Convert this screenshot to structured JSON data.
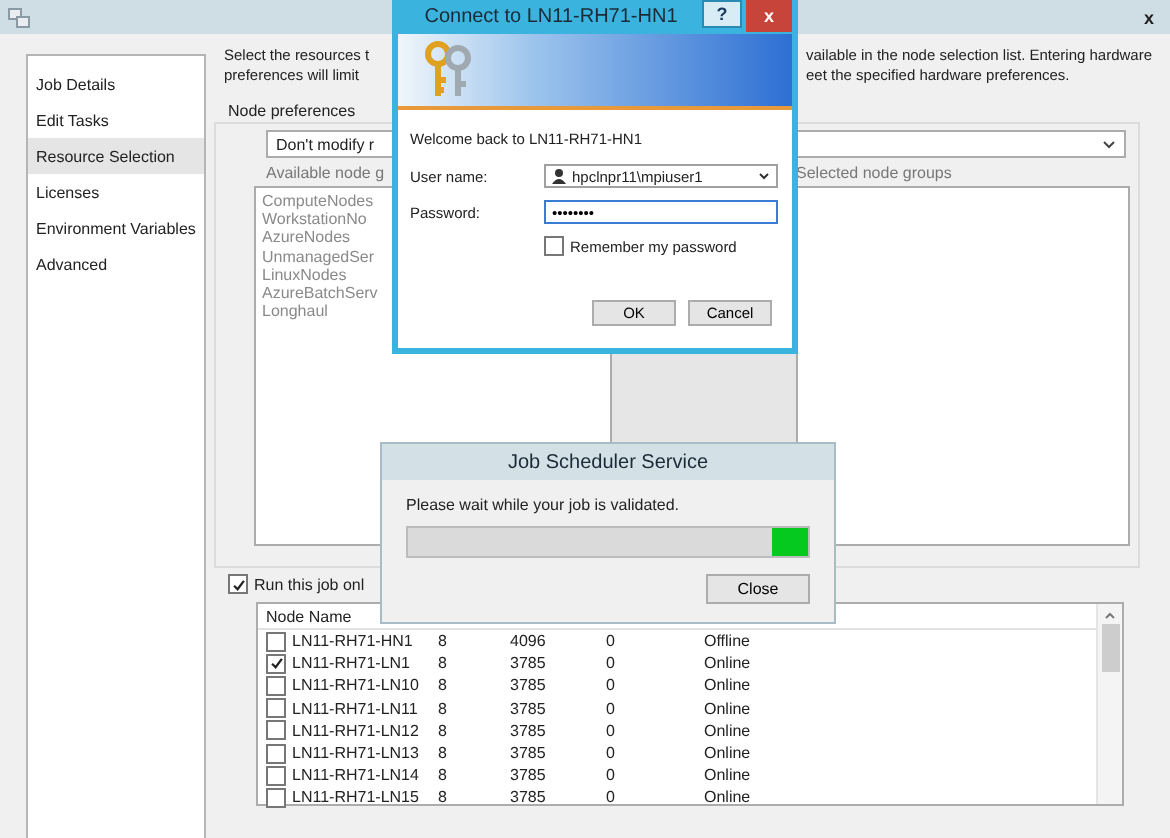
{
  "sidebar": {
    "items": [
      {
        "label": "Job Details",
        "selected": false
      },
      {
        "label": "Edit Tasks",
        "selected": false
      },
      {
        "label": "Resource Selection",
        "selected": true
      },
      {
        "label": "Licenses",
        "selected": false
      },
      {
        "label": "Environment Variables",
        "selected": false
      },
      {
        "label": "Advanced",
        "selected": false
      }
    ]
  },
  "description": {
    "left_lines": [
      "Select the resources t",
      "preferences will limit"
    ],
    "right_lines": [
      "vailable in the node selection list. Entering hardware",
      "eet the specified hardware preferences."
    ]
  },
  "node_preferences": {
    "title": "Node preferences",
    "dropdown": "Don't modify r",
    "available_label": "Available node g",
    "selected_label": "Selected node groups",
    "available_groups": [
      "ComputeNodes",
      "WorkstationNo",
      "AzureNodes",
      "UnmanagedSer",
      "LinuxNodes",
      "AzureBatchServ",
      "Longhaul"
    ]
  },
  "run_only": {
    "label": "Run this job onl",
    "checked": true
  },
  "table": {
    "columns": [
      "Node Name"
    ],
    "rows": [
      {
        "name": "LN11-RH71-HN1",
        "checked": false,
        "cores": "8",
        "memory": "4096",
        "gpus": "0",
        "state": "Offline"
      },
      {
        "name": "LN11-RH71-LN1",
        "checked": true,
        "cores": "8",
        "memory": "3785",
        "gpus": "0",
        "state": "Online"
      },
      {
        "name": "LN11-RH71-LN10",
        "checked": false,
        "cores": "8",
        "memory": "3785",
        "gpus": "0",
        "state": "Online"
      },
      {
        "name": "LN11-RH71-LN11",
        "checked": false,
        "cores": "8",
        "memory": "3785",
        "gpus": "0",
        "state": "Online"
      },
      {
        "name": "LN11-RH71-LN12",
        "checked": false,
        "cores": "8",
        "memory": "3785",
        "gpus": "0",
        "state": "Online"
      },
      {
        "name": "LN11-RH71-LN13",
        "checked": false,
        "cores": "8",
        "memory": "3785",
        "gpus": "0",
        "state": "Online"
      },
      {
        "name": "LN11-RH71-LN14",
        "checked": false,
        "cores": "8",
        "memory": "3785",
        "gpus": "0",
        "state": "Online"
      },
      {
        "name": "LN11-RH71-LN15",
        "checked": false,
        "cores": "8",
        "memory": "3785",
        "gpus": "0",
        "state": "Online"
      }
    ]
  },
  "window": {
    "close": "x"
  },
  "connect_dialog": {
    "title": "Connect to LN11-RH71-HN1",
    "help": "?",
    "close": "x",
    "welcome": "Welcome back to LN11-RH71-HN1",
    "username_label": "User name:",
    "username": "hpclnpr11\\mpiuser1",
    "password_label": "Password:",
    "password": "••••••••",
    "remember": {
      "label": "Remember my password",
      "checked": false
    },
    "buttons": [
      "OK",
      "Cancel"
    ]
  },
  "scheduler_dialog": {
    "title": "Job Scheduler Service",
    "message": "Please wait while your job is validated.",
    "button": "Close"
  }
}
